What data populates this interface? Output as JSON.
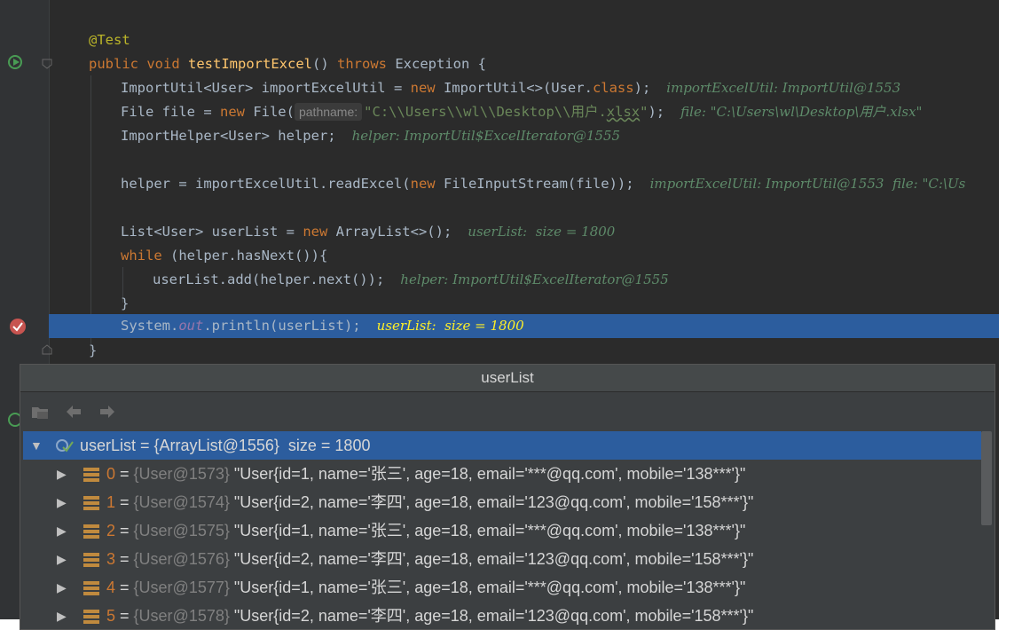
{
  "code": {
    "annotation": "@Test",
    "method": {
      "public": "public",
      "void": "void",
      "name": "testImportExcel",
      "parens": "() ",
      "throws": "throws",
      "exception": " Exception {"
    },
    "line1": {
      "type": "ImportUtil<User> importExcelUtil = ",
      "new": "new",
      "ctor": " ImportUtil<>(User.",
      "class": "class",
      "end": ");",
      "inline": "importExcelUtil: ImportUtil@1553"
    },
    "line2": {
      "type": "File file = ",
      "new": "new",
      "ctor": " File(",
      "hint": "pathname:",
      "str_a": "\"C:\\\\Users\\\\wl\\\\Desktop\\\\用户.",
      "str_ul": "xlsx",
      "str_b": "\"",
      "end": ");",
      "inline": "file: \"C:\\Users\\wl\\Desktop\\用户.xlsx\""
    },
    "line3": {
      "text": "ImportHelper<User> helper;",
      "inline": "helper: ImportUtil$ExcelIterator@1555"
    },
    "line4": {
      "a": "helper = importExcelUtil.readExcel(",
      "new": "new",
      "b": " FileInputStream(file));",
      "inline": "importExcelUtil: ImportUtil@1553  file: \"C:\\Us"
    },
    "line5": {
      "a": "List<User> userList = ",
      "new": "new",
      "b": " ArrayList<>();",
      "inline": "userList:  size = 1800"
    },
    "line6": {
      "while": "while",
      "b": " (helper.hasNext()){"
    },
    "line7": {
      "text": "userList.add(helper.next());",
      "inline": "helper: ImportUtil$ExcelIterator@1555"
    },
    "line8": {
      "text": "}"
    },
    "line9": {
      "a": "System.",
      "out": "out",
      "b": ".println(userList);",
      "inline": "userList:  size = 1800"
    },
    "line10": {
      "text": "}"
    }
  },
  "popup": {
    "title": "userList",
    "root": {
      "label": "userList = {ArrayList@1556}  size = 1800"
    },
    "items": [
      {
        "index": "0",
        "ref": "{User@1573}",
        "value": "\"User{id=1, name='张三', age=18, email='***@qq.com', mobile='138***'}\""
      },
      {
        "index": "1",
        "ref": "{User@1574}",
        "value": "\"User{id=2, name='李四', age=18, email='123@qq.com', mobile='158***'}\""
      },
      {
        "index": "2",
        "ref": "{User@1575}",
        "value": "\"User{id=1, name='张三', age=18, email='***@qq.com', mobile='138***'}\""
      },
      {
        "index": "3",
        "ref": "{User@1576}",
        "value": "\"User{id=2, name='李四', age=18, email='123@qq.com', mobile='158***'}\""
      },
      {
        "index": "4",
        "ref": "{User@1577}",
        "value": "\"User{id=1, name='张三', age=18, email='***@qq.com', mobile='138***'}\""
      },
      {
        "index": "5",
        "ref": "{User@1578}",
        "value": "\"User{id=2, name='李四', age=18, email='123@qq.com', mobile='158***'}\""
      }
    ]
  },
  "icons": {
    "run": "run-gutter-icon",
    "breakpoint": "breakpoint-icon",
    "fold": "fold-icon",
    "watch": "watch-icon",
    "field": "field-icon"
  },
  "colors": {
    "editor_bg": "#2b2b2b",
    "highlight": "#2c5d9e",
    "keyword": "#cc7832",
    "inline_value": "#5e8b6a"
  }
}
